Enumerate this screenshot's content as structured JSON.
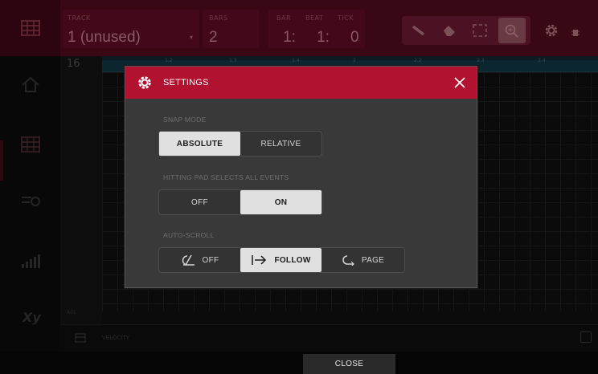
{
  "topbar": {
    "track_label": "TRACK",
    "track_value": "1  (unused)",
    "bars_label": "BARS",
    "bars_value": "2",
    "pos_labels": [
      "BAR",
      "BEAT",
      "TICK"
    ],
    "pos_values": [
      "1:",
      "1:",
      "0"
    ]
  },
  "grid": {
    "bars_count": "16",
    "ruler_ticks": [
      "1.2",
      "1.3",
      "1.4",
      "2",
      "2.2",
      "2.3",
      "2.4"
    ],
    "pad_name": "A01",
    "velocity_label": "VELOCITY"
  },
  "settings": {
    "title": "SETTINGS",
    "snap_mode": {
      "label": "SNAP MODE",
      "options": [
        "ABSOLUTE",
        "RELATIVE"
      ],
      "selected": "ABSOLUTE"
    },
    "hitting_pad": {
      "label": "HITTING PAD SELECTS ALL EVENTS",
      "options": [
        "OFF",
        "ON"
      ],
      "selected": "ON"
    },
    "auto_scroll": {
      "label": "AUTO-SCROLL",
      "options": [
        "OFF",
        "FOLLOW",
        "PAGE"
      ],
      "selected": "FOLLOW",
      "icons": [
        "scroll-off-icon",
        "follow-arrow-icon",
        "page-return-icon"
      ]
    }
  },
  "bottombar": {
    "close_label": "CLOSE"
  },
  "colors": {
    "header_red": "#b0122f",
    "modal_bg": "#393939",
    "selected_bg": "#e0e0e0"
  }
}
